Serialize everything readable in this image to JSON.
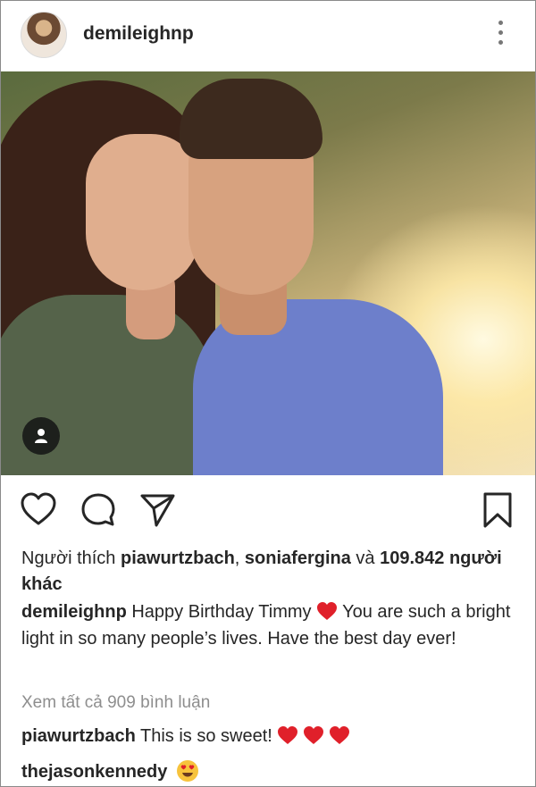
{
  "post": {
    "author": "demileighnp",
    "menu_icon": "more-vertical-icon"
  },
  "photo": {
    "tag_icon": "user-tag-icon"
  },
  "actions": {
    "like_icon": "heart-outline-icon",
    "comment_icon": "comment-bubble-icon",
    "share_icon": "send-paper-plane-icon",
    "save_icon": "bookmark-icon"
  },
  "likes": {
    "prefix": "Người thích",
    "user1": "piawurtzbach",
    "separator": ",",
    "user2": "soniafergina",
    "conjunction": "và",
    "count": "109.842",
    "suffix": "người khác"
  },
  "caption": {
    "username": "demileighnp",
    "text_before": "Happy Birthday Timmy",
    "text_after": "You are such a bright light in so many people’s lives. Have the best day ever!",
    "emoji": "red-heart"
  },
  "comments": {
    "view_all": "Xem tất cả 909 bình luận",
    "items": [
      {
        "username": "piawurtzbach",
        "text": "This is so sweet!",
        "emojis": [
          "red-heart",
          "red-heart",
          "red-heart"
        ]
      },
      {
        "username": "thejasonkennedy",
        "text": "",
        "emojis": [
          "heart-eyes-face"
        ]
      }
    ]
  },
  "colors": {
    "text": "#262626",
    "muted": "#8e8e8e",
    "heart_red": "#e0202a",
    "border": "#8a8a8a"
  }
}
